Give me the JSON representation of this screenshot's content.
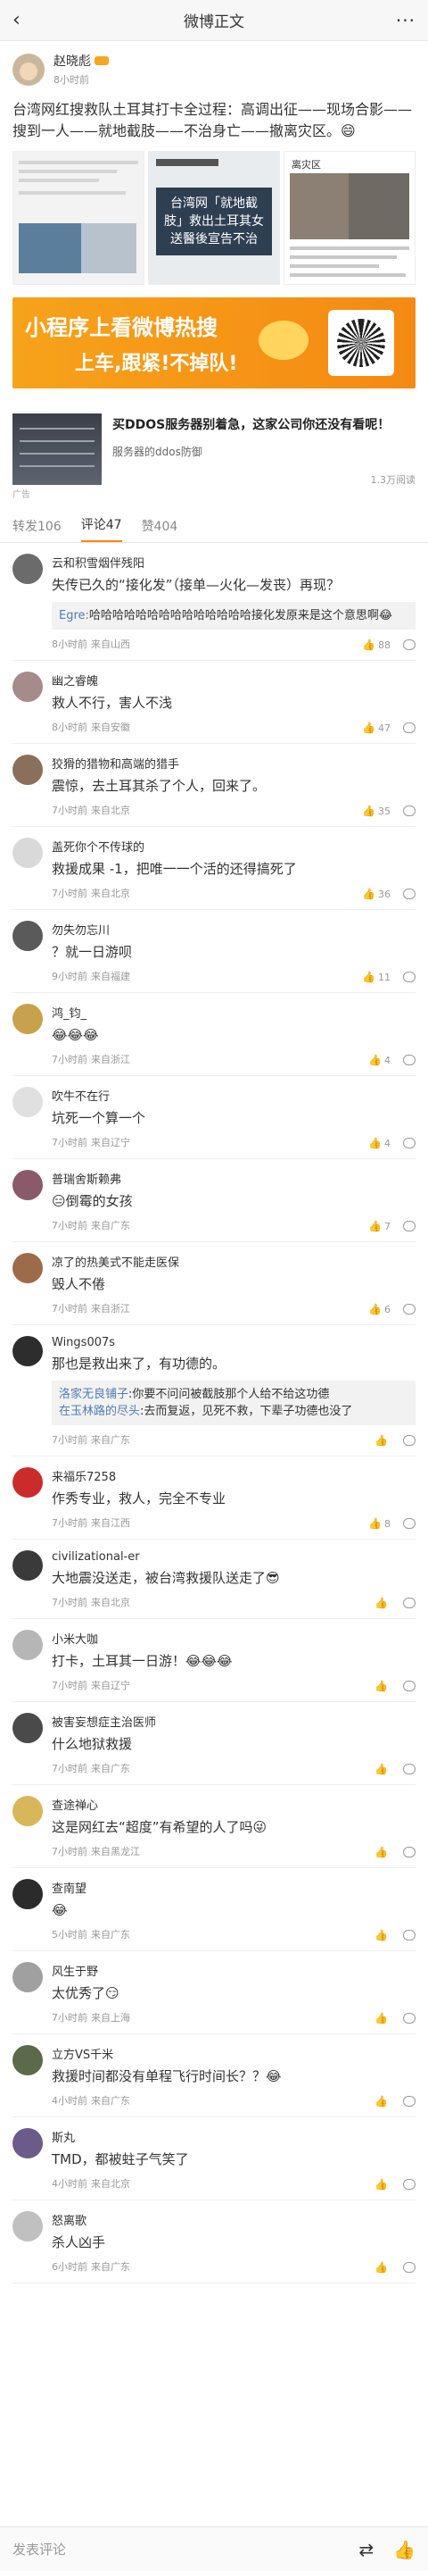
{
  "nav": {
    "title": "微博正文",
    "back_icon": "back-arrow-icon",
    "more_icon": "more-icon"
  },
  "post": {
    "author": "赵晓彪",
    "time": "8小时前",
    "text": "台湾网红搜救队土耳其打卡全过程：高调出征——现场合影——搜到一人——就地截肢——不治身亡——撤离灾区。😄",
    "pic2_text": "台湾网「就地截肢」救出土耳其女 送醫後宣告不治",
    "pic3_head": "离灾区"
  },
  "promo": {
    "line1": "小程序上看微博热搜",
    "line2": "上车,跟紧!不掉队!"
  },
  "ad": {
    "title": "买DDOS服务器别着急，这家公司你还没有看呢！",
    "sub": "服务器的ddos防御",
    "views": "1.3万阅读",
    "tag": "广告"
  },
  "tabs": [
    {
      "label": "转发106"
    },
    {
      "label": "评论47"
    },
    {
      "label": "赞404"
    }
  ],
  "comments": [
    {
      "name": "云和积雪烟伴残阳",
      "text": "失传已久的“接化发”（接单—火化—发丧）再现？",
      "reply": {
        "name": "Egre:",
        "text": "哈哈哈哈哈哈哈哈哈哈哈哈哈哈接化发原来是这个意思啊😂"
      },
      "time": "8小时前",
      "loc": "来自山西",
      "likes": "88"
    },
    {
      "name": "幽之睿魄",
      "text": "救人不行，害人不浅",
      "time": "8小时前",
      "loc": "来自安徽",
      "likes": "47"
    },
    {
      "name": "狡猾的猎物和高端的猎手",
      "text": "震惊，去土耳其杀了个人，回来了。",
      "time": "7小时前",
      "loc": "来自北京",
      "likes": "35"
    },
    {
      "name": "盖死你个不传球的",
      "text": "救援成果 -1，把唯一一个活的还得搞死了",
      "time": "7小时前",
      "loc": "来自北京",
      "likes": "36"
    },
    {
      "name": "勿失勿忘川",
      "text": "？就一日游呗",
      "time": "9小时前",
      "loc": "来自福建",
      "likes": "11"
    },
    {
      "name": "鸿_钧_",
      "text": "😂😂😂",
      "time": "7小时前",
      "loc": "来自浙江",
      "likes": "4"
    },
    {
      "name": "吹牛不在行",
      "text": "坑死一个算一个",
      "time": "7小时前",
      "loc": "来自辽宁",
      "likes": "4"
    },
    {
      "name": "普瑞舍斯赖弗",
      "text": "😑倒霉的女孩",
      "time": "7小时前",
      "loc": "来自广东",
      "likes": "7"
    },
    {
      "name": "凉了的热美式不能走医保",
      "text": "毁人不倦",
      "time": "7小时前",
      "loc": "来自浙江",
      "likes": "6"
    },
    {
      "name": "Wings007s",
      "text": "那也是救出来了，有功德的。",
      "reply": {
        "lines": [
          {
            "name": "洛家无良铺子",
            "text": ":你要不问问被截肢那个人给不给这功德"
          },
          {
            "name": "在玉林路的尽头",
            "text": ":去而复返，见死不救，下辈子功德也没了"
          }
        ]
      },
      "time": "7小时前",
      "loc": "来自广东",
      "likes": ""
    },
    {
      "name": "来福乐7258",
      "text": "作秀专业，救人，完全不专业",
      "time": "7小时前",
      "loc": "来自江西",
      "likes": "8"
    },
    {
      "name": "civilizational-er",
      "text": "大地震没送走，被台湾救援队送走了😎",
      "time": "7小时前",
      "loc": "来自北京",
      "likes": ""
    },
    {
      "name": "小米大咖",
      "text": "打卡，土耳其一日游！😂😂😂",
      "time": "7小时前",
      "loc": "来自辽宁",
      "likes": ""
    },
    {
      "name": "被害妄想症主治医师",
      "text": "什么地狱救援",
      "time": "7小时前",
      "loc": "来自广东",
      "likes": ""
    },
    {
      "name": "查途禅心",
      "text": "这是网红去“超度”有希望的人了吗😜",
      "time": "7小时前",
      "loc": "来自黑龙江",
      "likes": ""
    },
    {
      "name": "查南望",
      "text": "😂",
      "time": "5小时前",
      "loc": "来自广东",
      "likes": ""
    },
    {
      "name": "风生于野",
      "text": "太优秀了😏",
      "time": "7小时前",
      "loc": "来自上海",
      "likes": ""
    },
    {
      "name": "立方VS千米",
      "text": "救援时间都没有单程飞行时间长？？😂",
      "time": "4小时前",
      "loc": "来自广东",
      "likes": ""
    },
    {
      "name": "斯丸",
      "text": "TMD，都被蛀子气笑了",
      "time": "4小时前",
      "loc": "来自北京",
      "likes": ""
    },
    {
      "name": "怒离歌",
      "text": "杀人凶手",
      "time": "6小时前",
      "loc": "来自广东",
      "likes": ""
    }
  ],
  "bottom": {
    "placeholder": "发表评论",
    "repost_icon": "repost-icon",
    "like_icon": "thumb-up-icon"
  },
  "colors": {
    "accent": "#ff8200",
    "link": "#507daf",
    "promo": "#f7a21b"
  }
}
